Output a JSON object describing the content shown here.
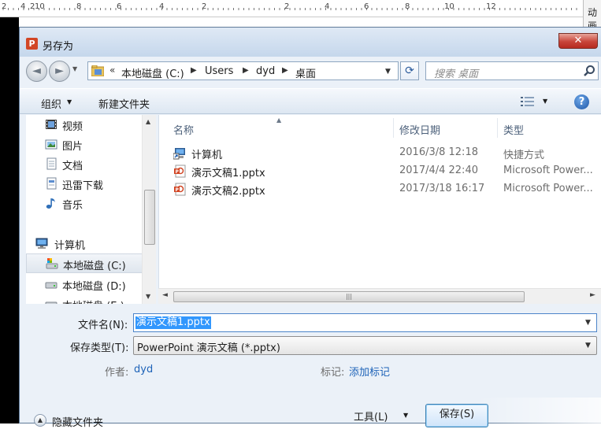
{
  "ruler": {
    "numbers": [
      "2",
      "4",
      "2",
      "10",
      "8",
      "6",
      "4",
      "2",
      "2",
      "4",
      "6",
      "8",
      "10",
      "12"
    ],
    "animation_tab_label": "动画"
  },
  "dialog": {
    "title": "另存为",
    "app_icon_letter": "P",
    "close_glyph": "✕"
  },
  "nav": {
    "back_glyph": "◄",
    "forward_glyph": "►",
    "address": {
      "chevron": "«",
      "crumbs": [
        "本地磁盘 (C:)",
        "Users",
        "dyd",
        "桌面"
      ]
    },
    "search_placeholder": "搜索 桌面"
  },
  "toolbar": {
    "organize_label": "组织",
    "new_folder_label": "新建文件夹"
  },
  "sidebar": {
    "items": [
      {
        "label": "视频",
        "icon": "video-icon"
      },
      {
        "label": "图片",
        "icon": "picture-icon"
      },
      {
        "label": "文档",
        "icon": "document-icon"
      },
      {
        "label": "迅雷下载",
        "icon": "download-icon"
      },
      {
        "label": "音乐",
        "icon": "music-icon"
      },
      {
        "label": "计算机",
        "icon": "computer-icon"
      },
      {
        "label": "本地磁盘 (C:)",
        "icon": "drive-icon",
        "selected": true
      },
      {
        "label": "本地磁盘 (D:)",
        "icon": "drive-icon"
      },
      {
        "label": "本地磁盘 (E:)",
        "icon": "drive-icon"
      }
    ]
  },
  "filelist": {
    "columns": [
      "名称",
      "修改日期",
      "类型"
    ],
    "rows": [
      {
        "name": "计算机",
        "date": "2016/3/8 12:18",
        "type": "快捷方式",
        "icon": "shortcut-icon"
      },
      {
        "name": "演示文稿1.pptx",
        "date": "2017/4/4 22:40",
        "type": "Microsoft Power...",
        "icon": "pptx-icon"
      },
      {
        "name": "演示文稿2.pptx",
        "date": "2017/3/18 16:17",
        "type": "Microsoft Power...",
        "icon": "pptx-icon"
      }
    ]
  },
  "form": {
    "filename_label": "文件名(N):",
    "filename_value": "演示文稿1.pptx",
    "filetype_label": "保存类型(T):",
    "filetype_value": "PowerPoint 演示文稿 (*.pptx)",
    "author_label": "作者:",
    "author_value": "dyd",
    "tags_label": "标记:",
    "tags_value": "添加标记"
  },
  "bottom": {
    "hide_folders_label": "隐藏文件夹",
    "tools_label": "工具(L)",
    "save_label": "保存(S)"
  },
  "colors": {
    "dialog_bg": "#ebf1f8",
    "close_red": "#c8453a",
    "selection_blue": "#3297fd",
    "link_blue": "#1e63b8",
    "pptx_red": "#d24625"
  }
}
